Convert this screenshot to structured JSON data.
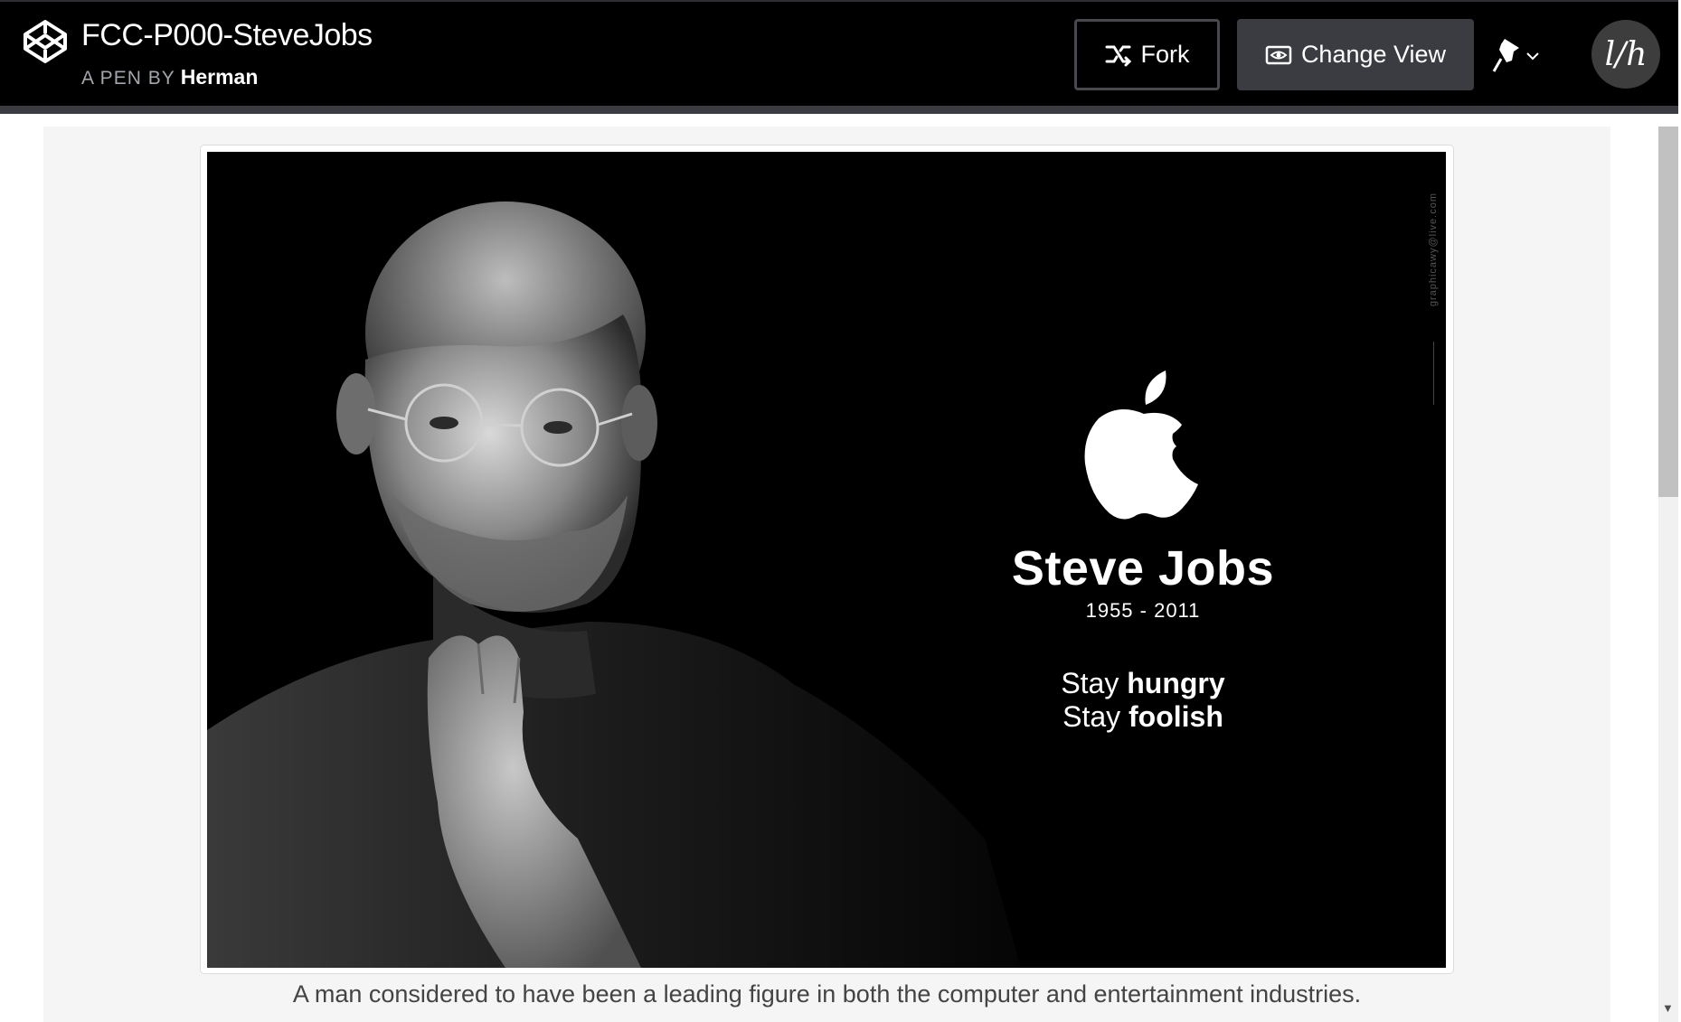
{
  "header": {
    "pen_title": "FCC-P000-SteveJobs",
    "byline_prefix": "A PEN BY",
    "author": "Herman",
    "fork_label": "Fork",
    "change_view_label": "Change View",
    "avatar_initials": "l/h"
  },
  "preview": {
    "photo": {
      "name": "Steve Jobs",
      "years": "1955 - 2011",
      "quote_line1_a": "Stay",
      "quote_line1_b": "hungry",
      "quote_line2_a": "Stay",
      "quote_line2_b": "foolish",
      "credit": "graphicawy@live.com"
    },
    "caption": "A man considered to have been a leading figure in both the computer and entertainment industries."
  },
  "colors": {
    "header_bg": "#000000",
    "button_bg": "#3a3c42",
    "preview_bg": "#f5f5f5",
    "caption_text": "#444444"
  }
}
